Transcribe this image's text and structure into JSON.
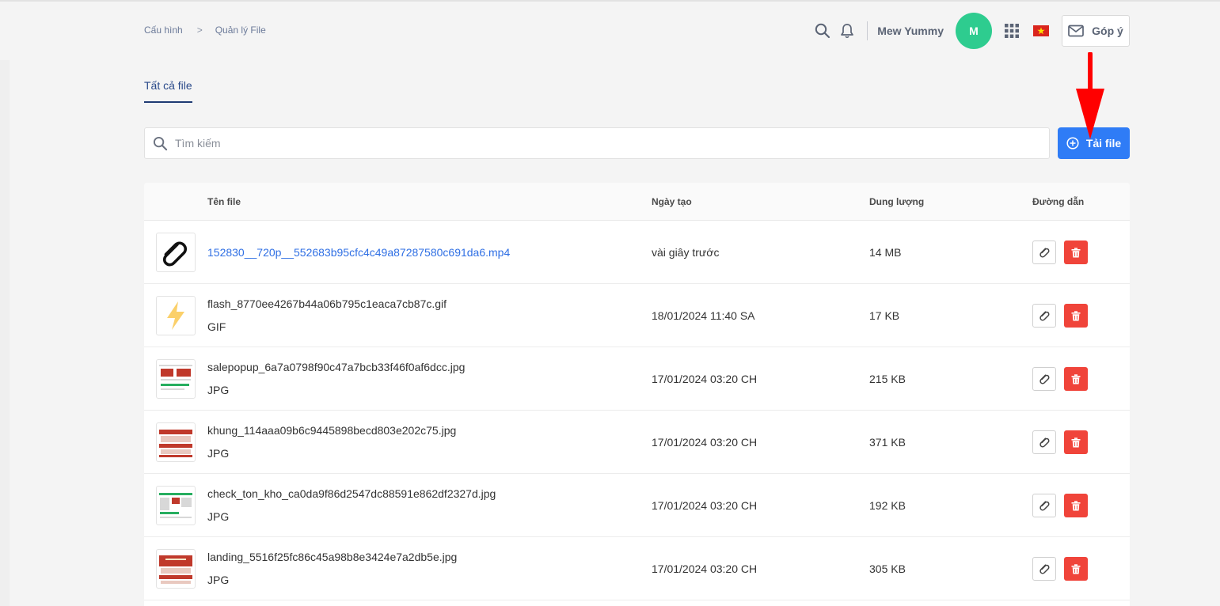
{
  "breadcrumb": {
    "root": "Cấu hình",
    "separator": ">",
    "current": "Quản lý File"
  },
  "header": {
    "username": "Mew Yummy",
    "avatar_initial": "M",
    "feedback_label": "Góp ý"
  },
  "tabs": {
    "all_files": "Tất cả file"
  },
  "search": {
    "placeholder": "Tìm kiếm"
  },
  "upload_button": {
    "label": "Tải file"
  },
  "table": {
    "columns": {
      "name": "Tên file",
      "created": "Ngày tạo",
      "size": "Dung lượng",
      "path": "Đường dẫn"
    },
    "rows": [
      {
        "name": "152830__720p__552683b95cfc4c49a87287580c691da6.mp4",
        "type": "",
        "created": "vài giây trước",
        "size": "14 MB",
        "thumb_icon": "paperclip-icon"
      },
      {
        "name": "flash_8770ee4267b44a06b795c1eaca7cb87c.gif",
        "type": "GIF",
        "created": "18/01/2024 11:40 SA",
        "size": "17 KB",
        "thumb_icon": "lightning-icon"
      },
      {
        "name": "salepopup_6a7a0798f90c47a7bcb33f46f0af6dcc.jpg",
        "type": "JPG",
        "created": "17/01/2024 03:20 CH",
        "size": "215 KB",
        "thumb_icon": "image-thumbnail"
      },
      {
        "name": "khung_114aaa09b6c9445898becd803e202c75.jpg",
        "type": "JPG",
        "created": "17/01/2024 03:20 CH",
        "size": "371 KB",
        "thumb_icon": "image-thumbnail"
      },
      {
        "name": "check_ton_kho_ca0da9f86d2547dc88591e862df2327d.jpg",
        "type": "JPG",
        "created": "17/01/2024 03:20 CH",
        "size": "192 KB",
        "thumb_icon": "image-thumbnail"
      },
      {
        "name": "landing_5516f25fc86c45a98b8e3424e7a2db5e.jpg",
        "type": "JPG",
        "created": "17/01/2024 03:20 CH",
        "size": "305 KB",
        "thumb_icon": "image-thumbnail"
      }
    ]
  },
  "colors": {
    "primary": "#2f7cf6",
    "danger": "#f0443a",
    "avatar": "#2ecc8f",
    "link": "#2f6fe4",
    "annotation_arrow": "#ff0000"
  }
}
